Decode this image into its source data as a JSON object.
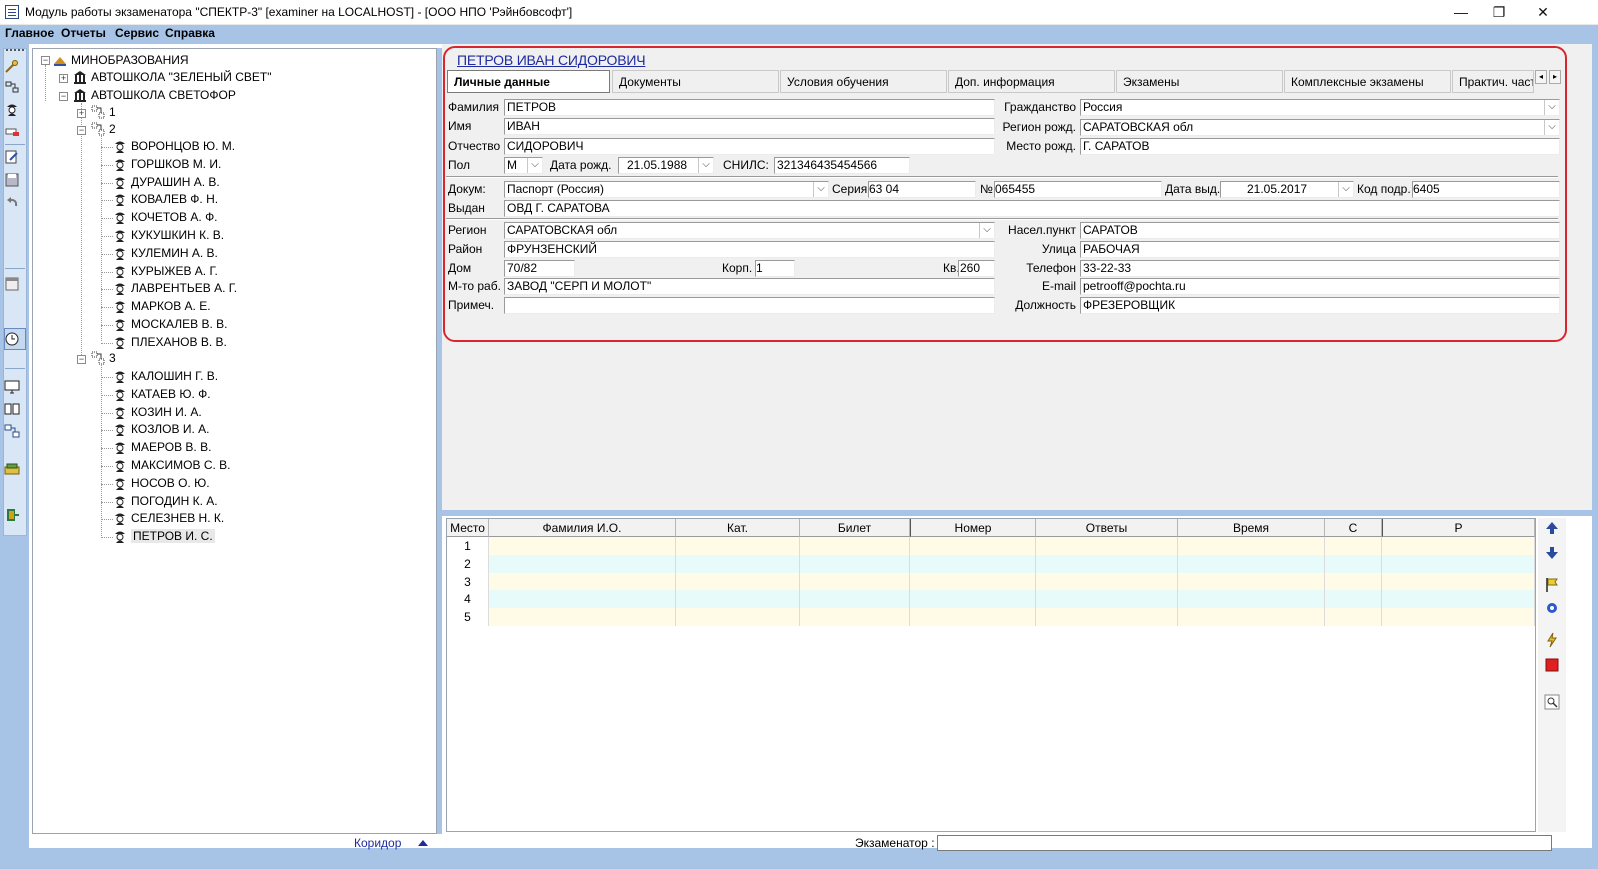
{
  "window": {
    "title": "Модуль работы экзаменатора \"СПЕКТР-3\" [examiner на LOCALHOST] - [ООО НПО 'Рэйнбовсофт']",
    "minimize": "—",
    "restore": "❐",
    "close": "✕"
  },
  "menu": [
    "Главное",
    "Отчеты",
    "Сервис",
    "Справка"
  ],
  "tree": {
    "root": "МИНОБРАЗОВАНИЯ",
    "schools": [
      "АВТОШКОЛА \"ЗЕЛЕНЫЙ СВЕТ\"",
      "АВТОШКОЛА СВЕТОФОР"
    ],
    "groups": [
      "1",
      "2",
      "3"
    ],
    "group2": [
      "ВОРОНЦОВ Ю. М.",
      "ГОРШКОВ М. И.",
      "ДУРАШИН А. В.",
      "КОВАЛЕВ Ф. Н.",
      "КОЧЕТОВ А. Ф.",
      "КУКУШКИН К. В.",
      "КУЛЕМИН А. В.",
      "КУРЫЖЕВ А. Г.",
      "ЛАВРЕНТЬЕВ А. Г.",
      "МАРКОВ А. Е.",
      "МОСКАЛЕВ В. В.",
      "ПЛЕХАНОВ В. В."
    ],
    "group3": [
      "КАЛОШИН Г. В.",
      "КАТАЕВ Ю. Ф.",
      "КОЗИН И. А.",
      "КОЗЛОВ И. А.",
      "МАЕРОВ В. В.",
      "МАКСИМОВ С. В.",
      "НОСОВ О. Ю.",
      "ПОГОДИН К. А.",
      "СЕЛЕЗНЕВ Н. К.",
      "ПЕТРОВ И. С."
    ]
  },
  "person": {
    "full_name": "ПЕТРОВ ИВАН СИДОРОВИЧ",
    "tabs": [
      "Личные данные",
      "Документы",
      "Условия обучения",
      "Доп. информация",
      "Экзамены",
      "Комплексные экзамены",
      "Практич. часть"
    ],
    "labels": {
      "surname": "Фамилия",
      "name": "Имя",
      "patronymic": "Отчество",
      "sex": "Пол",
      "birthdate": "Дата рожд.",
      "snils": "СНИЛС:",
      "citizenship": "Гражданство",
      "birth_region": "Регион рожд.",
      "birth_place": "Место рожд.",
      "doc": "Докум:",
      "series": "Серия",
      "number": "№",
      "issue_date": "Дата выд.",
      "dept_code": "Код подр.",
      "issued_by": "Выдан",
      "region": "Регион",
      "district": "Район",
      "house": "Дом",
      "building": "Корп.",
      "apartment": "Кв.",
      "workplace": "М-то раб.",
      "note": "Примеч.",
      "settlement": "Насел.пункт",
      "street": "Улица",
      "phone": "Телефон",
      "email": "E-mail",
      "position": "Должность"
    },
    "values": {
      "surname": "ПЕТРОВ",
      "name": "ИВАН",
      "patronymic": "СИДОРОВИЧ",
      "sex": "М",
      "birthdate": "21.05.1988",
      "snils": "321346435454566",
      "citizenship": "Россия",
      "birth_region": "САРАТОВСКАЯ обл",
      "birth_place": "Г. САРАТОВ",
      "doc": "Паспорт (Россия)",
      "series": "63 04",
      "number": "065455",
      "issue_date": "21.05.2017",
      "dept_code": "6405",
      "issued_by": "ОВД Г. САРАТОВА",
      "region": "САРАТОВСКАЯ обл",
      "district": "ФРУНЗЕНСКИЙ",
      "house": "70/82",
      "building": "1",
      "apartment": "260",
      "workplace": "ЗАВОД \"СЕРП И МОЛОТ\"",
      "note": "",
      "settlement": "САРАТОВ",
      "street": "РАБОЧАЯ",
      "phone": "33-22-33",
      "email": "petrooff@pochta.ru",
      "position": "ФРЕЗЕРОВЩИК"
    }
  },
  "grid": {
    "columns": [
      "Место",
      "Фамилия И.О.",
      "Кат.",
      "Билет",
      "Номер",
      "Ответы",
      "Время",
      "С",
      "Р"
    ],
    "rows": [
      "1",
      "2",
      "3",
      "4",
      "5"
    ],
    "row_colors": [
      "#fffbe6",
      "#e8fbfb",
      "#fffbe6",
      "#e8fbfb",
      "#fffbe6"
    ]
  },
  "status": {
    "corridor": "Коридор",
    "examiner_label": "Экзаменатор :"
  },
  "colors": {
    "frame": "#a7c4e6",
    "accent_red": "#d7262e",
    "name_link": "#1e2aa0"
  }
}
